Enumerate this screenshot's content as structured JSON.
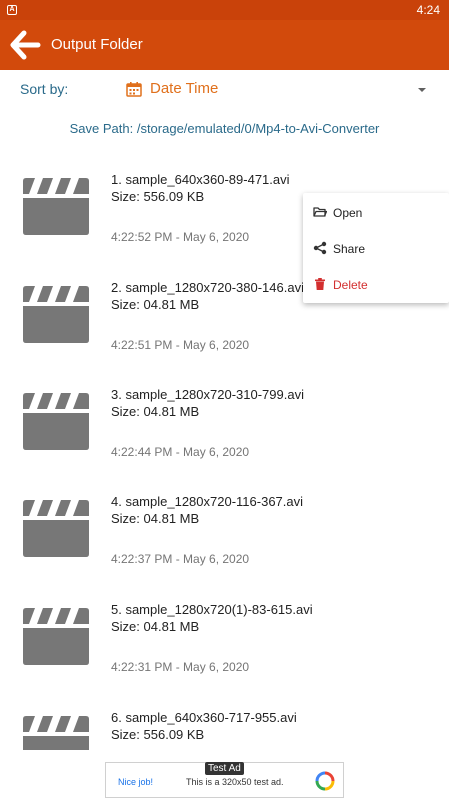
{
  "status_bar": {
    "app_icon_letter": "A",
    "time": "4:24"
  },
  "app_bar": {
    "title": "Output Folder",
    "back_icon": "arrow-back-icon"
  },
  "sort": {
    "label": "Sort by:",
    "value": "Date Time",
    "icon": "calendar-icon"
  },
  "save_path": "Save Path: /storage/emulated/0/Mp4-to-Avi-Converter",
  "files": [
    {
      "name": "1. sample_640x360-89-471.avi",
      "size": "Size: 556.09 KB",
      "date": "4:22:52 PM - May 6, 2020"
    },
    {
      "name": "2. sample_1280x720-380-146.avi",
      "size": "Size: 04.81 MB",
      "date": "4:22:51 PM - May 6, 2020"
    },
    {
      "name": "3. sample_1280x720-310-799.avi",
      "size": "Size: 04.81 MB",
      "date": "4:22:44 PM - May 6, 2020"
    },
    {
      "name": "4. sample_1280x720-116-367.avi",
      "size": "Size: 04.81 MB",
      "date": "4:22:37 PM - May 6, 2020"
    },
    {
      "name": "5. sample_1280x720(1)-83-615.avi",
      "size": "Size: 04.81 MB",
      "date": "4:22:31 PM - May 6, 2020"
    },
    {
      "name": "6. sample_640x360-717-955.avi",
      "size": "Size: 556.09 KB",
      "date": ""
    }
  ],
  "context_menu": {
    "items": [
      {
        "label": "Open",
        "icon": "folder-open-icon"
      },
      {
        "label": "Share",
        "icon": "share-icon"
      },
      {
        "label": "Delete",
        "icon": "trash-icon"
      }
    ]
  },
  "ad": {
    "badge": "Test Ad",
    "nice_job": "Nice job!",
    "text": "This is a 320x50 test ad."
  },
  "colors": {
    "primary": "#d24a0c",
    "status_bar": "#c9420a",
    "accent": "#e0701c",
    "link_text": "#2a6a8a",
    "danger": "#d32f2f"
  }
}
